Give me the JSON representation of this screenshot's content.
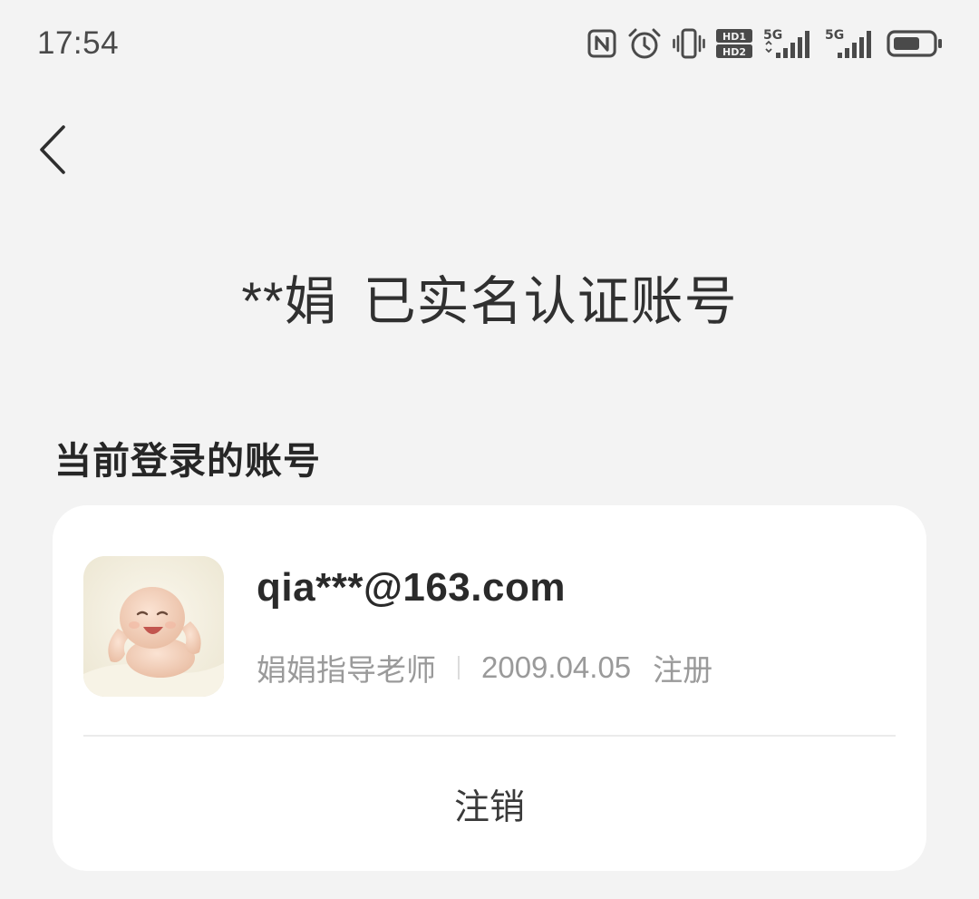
{
  "status_bar": {
    "time": "17:54",
    "icons": [
      "nfc-icon",
      "alarm-icon",
      "vibrate-icon",
      "hd-icon",
      "signal-5g-icon",
      "signal-5g-icon",
      "battery-icon"
    ],
    "network_label_1": "5G",
    "network_label_2": "5G",
    "hd_label_top": "HD1",
    "hd_label_bottom": "HD2"
  },
  "header": {
    "back_icon": "chevron-left-icon",
    "title_name": "**娟",
    "title_text": "已实名认证账号"
  },
  "section": {
    "label": "当前登录的账号"
  },
  "account": {
    "email": "qia***@163.com",
    "nickname": "娟娟指导老师",
    "register_date": "2009.04.05",
    "register_suffix": "注册",
    "logout_label": "注销"
  }
}
